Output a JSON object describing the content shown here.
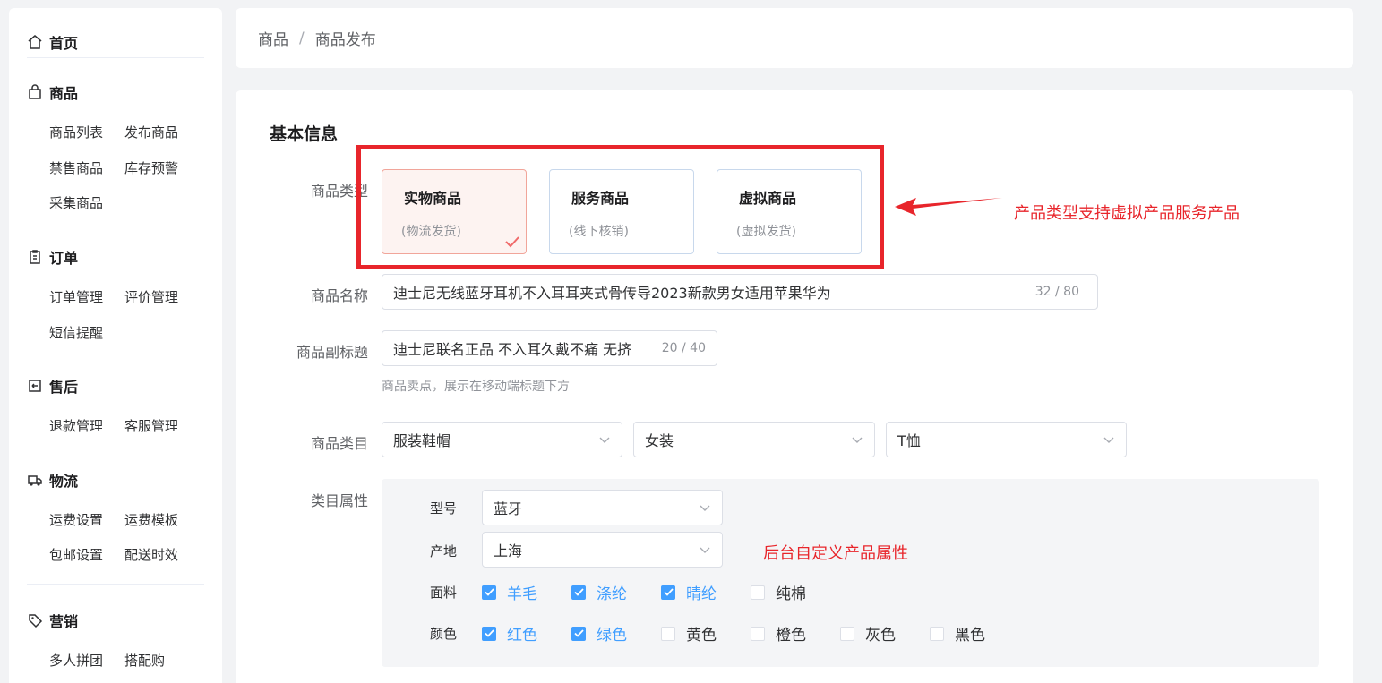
{
  "sidebar": {
    "home": "首页",
    "groups": [
      {
        "title": "商品",
        "icon": "bag-icon",
        "items": [
          "商品列表",
          "发布商品",
          "禁售商品",
          "库存预警",
          "采集商品"
        ]
      },
      {
        "title": "订单",
        "icon": "clipboard-icon",
        "items": [
          "订单管理",
          "评价管理",
          "短信提醒"
        ]
      },
      {
        "title": "售后",
        "icon": "return-icon",
        "items": [
          "退款管理",
          "客服管理"
        ]
      },
      {
        "title": "物流",
        "icon": "truck-icon",
        "items": [
          "运费设置",
          "运费模板",
          "包邮设置",
          "配送时效"
        ]
      },
      {
        "title": "营销",
        "icon": "tag-icon",
        "items": [
          "多人拼团",
          "搭配购"
        ]
      }
    ]
  },
  "breadcrumb": {
    "parent": "商品",
    "separator": "/",
    "current": "商品发布"
  },
  "form": {
    "section_title": "基本信息",
    "labels": {
      "type": "商品类型",
      "name": "商品名称",
      "subtitle": "商品副标题",
      "category": "商品类目",
      "attributes": "类目属性"
    },
    "types": [
      {
        "title": "实物商品",
        "sub": "(物流发货)",
        "selected": true
      },
      {
        "title": "服务商品",
        "sub": "(线下核销)",
        "selected": false
      },
      {
        "title": "虚拟商品",
        "sub": "(虚拟发货)",
        "selected": false
      }
    ],
    "name": {
      "value": "迪士尼无线蓝牙耳机不入耳耳夹式骨传导2023新款男女适用苹果华为",
      "count": "32 / 80"
    },
    "subtitle": {
      "value": "迪士尼联名正品 不入耳久戴不痛 无挤",
      "count": "20 / 40",
      "hint": "商品卖点，展示在移动端标题下方"
    },
    "category": [
      "服装鞋帽",
      "女装",
      "T恤"
    ],
    "attributes": {
      "model_label": "型号",
      "model_value": "蓝牙",
      "origin_label": "产地",
      "origin_value": "上海",
      "material_label": "面料",
      "materials": [
        {
          "label": "羊毛",
          "checked": true
        },
        {
          "label": "涤纶",
          "checked": true
        },
        {
          "label": "晴纶",
          "checked": true
        },
        {
          "label": "纯棉",
          "checked": false
        }
      ],
      "color_label": "颜色",
      "colors": [
        {
          "label": "红色",
          "checked": true
        },
        {
          "label": "绿色",
          "checked": true
        },
        {
          "label": "黄色",
          "checked": false
        },
        {
          "label": "橙色",
          "checked": false
        },
        {
          "label": "灰色",
          "checked": false
        },
        {
          "label": "黑色",
          "checked": false
        }
      ]
    }
  },
  "annotations": {
    "type_note": "产品类型支持虚拟产品服务产品",
    "attr_note": "后台自定义产品属性"
  },
  "colors": {
    "accent": "#409eff",
    "annotation": "#e8252b",
    "selected_border": "#f1a59a"
  }
}
